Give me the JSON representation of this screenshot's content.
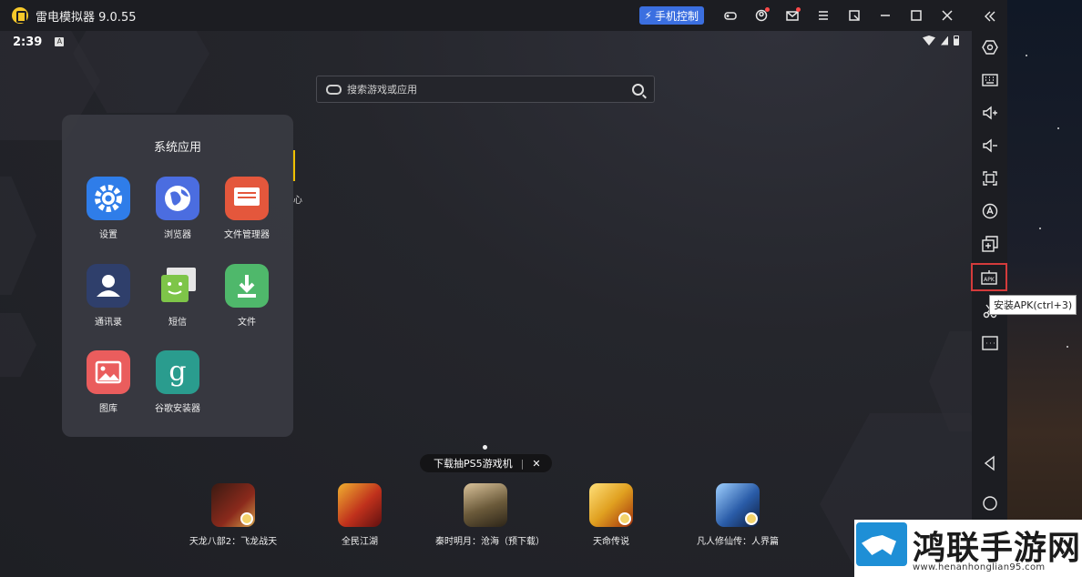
{
  "titlebar": {
    "app_title": "雷电模拟器 9.0.55",
    "phone_control": "手机控制",
    "icons": [
      "gamepad-icon",
      "user-icon",
      "mail-icon",
      "menu-icon",
      "restore-icon",
      "minimize-icon",
      "maximize-icon",
      "close-icon"
    ]
  },
  "statusbar": {
    "time": "2:39",
    "notif": "A"
  },
  "search": {
    "placeholder": "搜索游戏或应用"
  },
  "folder": {
    "title": "系统应用",
    "apps": [
      {
        "label": "设置",
        "color": "#2f7de9",
        "icon": "gear-icon"
      },
      {
        "label": "浏览器",
        "color": "#4b6de0",
        "icon": "globe-icon"
      },
      {
        "label": "文件管理器",
        "color": "#e4573c",
        "icon": "folder-icon"
      },
      {
        "label": "通讯录",
        "color": "#2f3f6b",
        "icon": "contact-icon"
      },
      {
        "label": "短信",
        "color": "#7ec549",
        "icon": "sms-icon"
      },
      {
        "label": "文件",
        "color": "#4fb86b",
        "icon": "download-icon"
      },
      {
        "label": "图库",
        "color": "#ea5d5d",
        "icon": "gallery-icon"
      },
      {
        "label": "谷歌安装器",
        "color": "#2a9c8e",
        "icon": "google-installer-icon"
      }
    ]
  },
  "peek_text": "心",
  "dock": {
    "promo": "下载抽PS5游戏机",
    "promo_close": "✕",
    "games": [
      {
        "label": "天龙八部2：飞龙战天",
        "color": "#8b2a1c"
      },
      {
        "label": "全民江湖",
        "color": "#c0311c"
      },
      {
        "label": "秦时明月：沧海（预下载）",
        "color": "#6b5a3a"
      },
      {
        "label": "天命传说",
        "color": "#e0a020"
      },
      {
        "label": "凡人修仙传：人界篇",
        "color": "#2a5ca8"
      }
    ]
  },
  "sidebar": {
    "items": [
      "collapse-icon",
      "settings-hex-icon",
      "keyboard-icon",
      "volume-up-icon",
      "volume-down-icon",
      "screenshot-icon",
      "auto-icon",
      "multi-instance-icon",
      "apk-install-icon",
      "scissors-icon",
      "more-icon",
      "back-icon",
      "home-icon"
    ],
    "apk_tooltip": "安装APK(ctrl+3)"
  },
  "watermark": {
    "title": "鸿联手游网",
    "url": "www.henanhonglian95.com"
  }
}
